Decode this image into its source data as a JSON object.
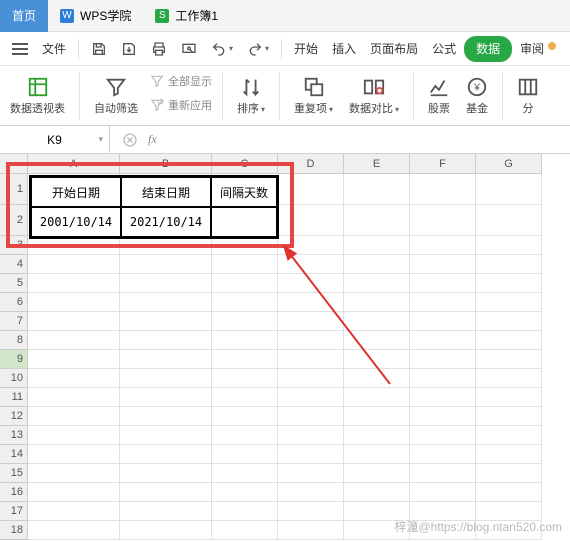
{
  "tabs": {
    "home": "首页",
    "wps": "WPS学院",
    "workbook": "工作簿1"
  },
  "menubar": {
    "file": "文件",
    "start": "开始",
    "insert": "插入",
    "page_layout": "页面布局",
    "formula": "公式",
    "data": "数据",
    "review": "审阅"
  },
  "ribbon": {
    "pivot": "数据透视表",
    "autofilter": "自动筛选",
    "show_all": "全部显示",
    "reapply": "重新应用",
    "sort": "排序",
    "dedupe": "重复项",
    "compare": "数据对比",
    "stock": "股票",
    "fund": "基金",
    "split": "分"
  },
  "namebox": {
    "cell_ref": "K9"
  },
  "columns": [
    "A",
    "B",
    "C",
    "D",
    "E",
    "F",
    "G"
  ],
  "rows": [
    1,
    2,
    3,
    4,
    5,
    6,
    7,
    8,
    9,
    10,
    11,
    12,
    13,
    14,
    15,
    16,
    17,
    18
  ],
  "selected_row": 9,
  "table": {
    "headers": [
      "开始日期",
      "结束日期",
      "间隔天数"
    ],
    "r1": [
      "2001/10/14",
      "2021/10/14",
      ""
    ]
  },
  "watermark": "梓潼@https://blog.ntan520.com"
}
